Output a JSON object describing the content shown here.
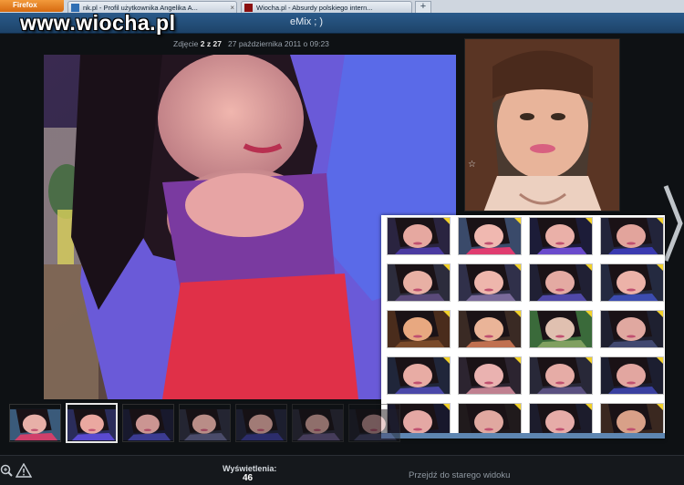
{
  "browser": {
    "app_button": "Firefox",
    "tabs": [
      {
        "label": "nk.pl - Profil użytkownika Angelika A..."
      },
      {
        "label": "Wiocha.pl - Absurdy polskiego intern..."
      }
    ],
    "new_tab": "+"
  },
  "watermark": "www.wiocha.pl",
  "header": {
    "title": "eMix ; )"
  },
  "photo_info": {
    "prefix": "Zdjęcie ",
    "index": "2 z 27",
    "date": "27 października 2011 o 09:23"
  },
  "side_photo": {
    "star": "☆"
  },
  "footer": {
    "views_label": "Wyświetlenia:",
    "views_count": "46",
    "old_view_link": "Przejdź do starego widoku"
  },
  "colors": {
    "header": "#1d4369",
    "accent": "#f2d12a",
    "background": "#0e1114"
  }
}
